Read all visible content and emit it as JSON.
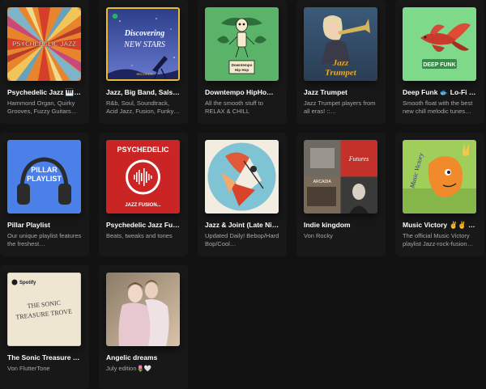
{
  "colors": {
    "background": "#121212",
    "card": "#181818",
    "title_text": "#ffffff",
    "desc_text": "#a7a7a7"
  },
  "playlists": [
    {
      "title": "Psychedelic Jazz 🎹🎷",
      "description": "Hammond Organ, Quirky Grooves, Fuzzy Guitars…",
      "cover_text": "PSYCHEDELIC JAZZ",
      "cover_icon": "sunburst-cover"
    },
    {
      "title": "Jazz, Big Band, Sals…",
      "description": "R&b, Soul, Soundtrack, Acid Jazz, Fusion, Funky…",
      "cover_text": "Discovering NEW STARS",
      "cover_icon": "night-sky-cover"
    },
    {
      "title": "Downtempo HipHo…",
      "description": "All the smooth stuff to RELAX & CHILL",
      "cover_text": "",
      "cover_icon": "skeleton-cover"
    },
    {
      "title": "Jazz Trumpet",
      "description": "Jazz Trumpet players from all eras! ::…",
      "cover_text": "Jazz Trumpet",
      "cover_icon": "trumpet-player-cover"
    },
    {
      "title": "Deep Funk 🐟 Lo-Fi …",
      "description": "Smooth float with the best new chill melodic tunes…",
      "cover_text": "DEEP FUNK",
      "cover_icon": "betta-fish-cover"
    },
    {
      "title": "Pillar Playlist",
      "description": "Our unique playlist features the freshest…",
      "cover_text": "PILLAR PLAYLIST",
      "cover_icon": "headphones-cover"
    },
    {
      "title": "Psychedelic Jazz Fu…",
      "description": "Beats, tweaks and tones",
      "cover_text": "PSYCHEDELIC",
      "cover_subtext": "JAZZ FUSION...",
      "cover_icon": "soundwave-cover"
    },
    {
      "title": "Jazz & Joint (Late Ni…",
      "description": "Updated Daily! Bebop/Hard Bop/Cool…",
      "cover_text": "",
      "cover_icon": "abstract-saxophone-cover"
    },
    {
      "title": "Indie kingdom",
      "description": "Von Rocky",
      "cover_text": "ARCADIA",
      "cover_subtext": "Futures",
      "cover_icon": "collage-cover"
    },
    {
      "title": "Music Victory ✌️✌️ J…",
      "description": "The official Music Victory playlist Jazz-rock-fusion…",
      "cover_text": "Music Victory",
      "cover_icon": "victory-face-cover"
    },
    {
      "title": "The Sonic Treasure …",
      "description": "Von FlutterTone",
      "cover_text": "THE SONIC TREASURE TROVE",
      "cover_subtext": "Spotify",
      "cover_icon": "paper-cover"
    },
    {
      "title": "Angelic dreams",
      "description": "July edition🌷🤍",
      "cover_text": "",
      "cover_icon": "painting-cover"
    }
  ]
}
